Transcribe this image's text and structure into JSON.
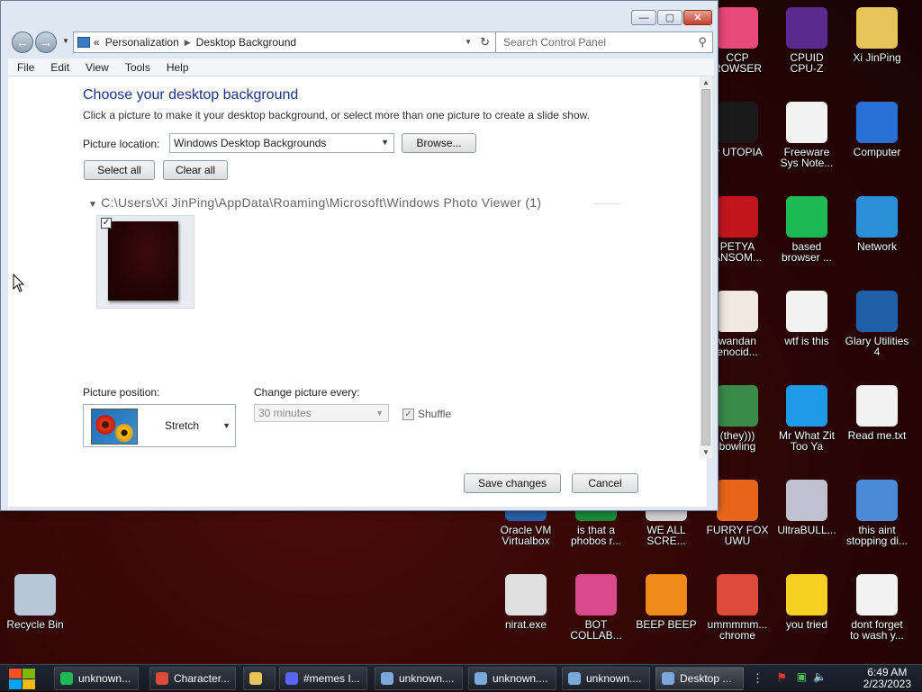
{
  "window": {
    "breadcrumb": [
      "Personalization",
      "Desktop Background"
    ],
    "breadcrumb_prefix": "«",
    "search_placeholder": "Search Control Panel",
    "buttons": {
      "minimize": "—",
      "maximize": "▢",
      "close": "✕"
    },
    "menu": [
      "File",
      "Edit",
      "View",
      "Tools",
      "Help"
    ],
    "heading": "Choose your desktop background",
    "description": "Click a picture to make it your desktop background, or select more than one picture to create a slide show.",
    "picture_location_label": "Picture location:",
    "picture_location_value": "Windows Desktop Backgrounds",
    "browse_label": "Browse...",
    "select_all_label": "Select all",
    "clear_all_label": "Clear all",
    "group_path": "C:\\Users\\Xi JinPing\\AppData\\Roaming\\Microsoft\\Windows Photo Viewer (1)",
    "picture_checked": true,
    "picture_position_label": "Picture position:",
    "picture_position_value": "Stretch",
    "change_every_label": "Change picture every:",
    "change_every_value": "30 minutes",
    "shuffle_label": "Shuffle",
    "save_label": "Save changes",
    "cancel_label": "Cancel"
  },
  "desktop_icons": [
    {
      "label": "CCP\nROWSER",
      "icon": "browser-icon",
      "color": "#e84a7a"
    },
    {
      "label": "CPUID\nCPU-Z",
      "icon": "cpu-z-icon",
      "color": "#5b2a8e"
    },
    {
      "label": "Xi JinPing",
      "icon": "user-folder-icon",
      "color": "#e8c45a"
    },
    {
      "label": "P UTOPIA",
      "icon": "utopia-icon",
      "color": "#1a1a1a"
    },
    {
      "label": "Freeware\nSys Note...",
      "icon": "document-icon",
      "color": "#f2f2f2"
    },
    {
      "label": "Computer",
      "icon": "computer-icon",
      "color": "#2a6fd6"
    },
    {
      "label": "PETYA\nANSOM...",
      "icon": "skull-icon",
      "color": "#c0161b"
    },
    {
      "label": "based\nbrowser ...",
      "icon": "chat-icon",
      "color": "#1db954"
    },
    {
      "label": "Network",
      "icon": "network-icon",
      "color": "#2a8fd6"
    },
    {
      "label": "wandan\nenocid...",
      "icon": "meme-icon",
      "color": "#f0e8e0"
    },
    {
      "label": "wtf is this",
      "icon": "grid-document-icon",
      "color": "#f2f2f2"
    },
    {
      "label": "Glary Utilities\n4",
      "icon": "glary-icon",
      "color": "#1e5fa8"
    },
    {
      "label": "(they)))\nbowling",
      "icon": "meme-face-icon",
      "color": "#3a8a4a"
    },
    {
      "label": "Mr What Zit\nToo Ya",
      "icon": "skype-icon",
      "color": "#1e9be8"
    },
    {
      "label": "Read me.txt",
      "icon": "text-file-icon",
      "color": "#f2f2f2"
    },
    {
      "label": "Oracle VM\nVirtualbox",
      "icon": "virtualbox-icon",
      "color": "#2a5fa8"
    },
    {
      "label": "is that a\nphobos r...",
      "icon": "app-icon",
      "color": "#1a8a3a"
    },
    {
      "label": "WE ALL\nSCRE...",
      "icon": "app-icon-2",
      "color": "#d0d0d0"
    },
    {
      "label": "FURRY FOX\nUWU",
      "icon": "firefox-icon",
      "color": "#e8661a"
    },
    {
      "label": "UltraBULL...",
      "icon": "disc-icon",
      "color": "#c0c0d0"
    },
    {
      "label": "this aint\nstopping di...",
      "icon": "installer-icon",
      "color": "#4a8ad6"
    },
    {
      "label": "Recycle Bin",
      "icon": "recycle-bin-icon",
      "color": "#b8c8d8"
    },
    {
      "label": "nirat.exe",
      "icon": "skull-exe-icon",
      "color": "#e0e0e0"
    },
    {
      "label": "BOT\nCOLLAB...",
      "icon": "monitor-icon",
      "color": "#d84a8a"
    },
    {
      "label": "BEEP BEEP",
      "icon": "vlc-icon",
      "color": "#f08a1a"
    },
    {
      "label": "ummmmm...\nchrome",
      "icon": "chrome-icon",
      "color": "#dd4b39"
    },
    {
      "label": "you tried",
      "icon": "star-icon",
      "color": "#f5d020"
    },
    {
      "label": "dont forget\nto wash y...",
      "icon": "grid-document-icon-2",
      "color": "#f2f2f2"
    }
  ],
  "taskbar": {
    "items": [
      {
        "label": "unknown...",
        "icon": "spotify-icon",
        "color": "#1db954"
      },
      {
        "label": "Character...",
        "icon": "chrome-icon",
        "color": "#dd4b39"
      },
      {
        "label": "",
        "icon": "folder-icon",
        "color": "#e8c45a"
      },
      {
        "label": "#memes I...",
        "icon": "discord-icon",
        "color": "#5865f2"
      },
      {
        "label": "unknown....",
        "icon": "window-icon",
        "color": "#7aa8d8"
      },
      {
        "label": "unknown....",
        "icon": "window-icon-2",
        "color": "#7aa8d8"
      },
      {
        "label": "unknown....",
        "icon": "window-icon-3",
        "color": "#7aa8d8"
      },
      {
        "label": "Desktop ...",
        "icon": "control-panel-icon",
        "color": "#7aa8d8"
      }
    ],
    "time": "6:49 AM",
    "date": "2/23/2023"
  }
}
